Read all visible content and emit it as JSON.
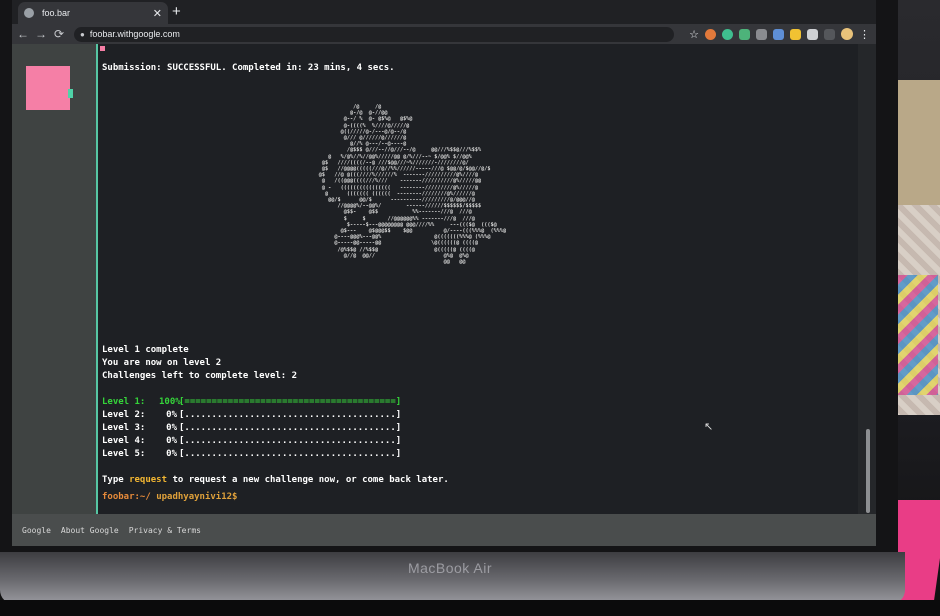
{
  "browser": {
    "tab_title": "foo.bar",
    "tab_close": "✕",
    "new_tab": "+",
    "back": "←",
    "forward": "→",
    "reload": "⟳",
    "lock_icon": "🔒",
    "url": "foobar.withgoogle.com",
    "star": "☆",
    "menu": "⋮"
  },
  "terminal": {
    "submission": "Submission: SUCCESSFUL. Completed in: 23 mins, 4 secs.",
    "level_complete": "Level 1 complete",
    "now_on_level": "You are now on level 2",
    "challenges_left": "Challenges left to complete level: 2",
    "levels": [
      {
        "label": "Level 1:",
        "pct": "100%",
        "bar": "[=======================================]",
        "percent": 100
      },
      {
        "label": "Level 2:",
        "pct": "0%",
        "bar": "[.......................................]",
        "percent": 0
      },
      {
        "label": "Level 3:",
        "pct": "0%",
        "bar": "[.......................................]",
        "percent": 0
      },
      {
        "label": "Level 4:",
        "pct": "0%",
        "bar": "[.......................................]",
        "percent": 0
      },
      {
        "label": "Level 5:",
        "pct": "0%",
        "bar": "[.......................................]",
        "percent": 0
      }
    ],
    "type_prefix": "Type ",
    "type_keyword": "request",
    "type_suffix": " to request a new challenge now, or come back later.",
    "prompt_path": "foobar:~/",
    "prompt_user": " upadhyaynivi12$"
  },
  "footer": {
    "google": "Google",
    "about": "About Google",
    "privacy": "Privacy & Terms"
  },
  "device": {
    "label": "MacBook Air"
  },
  "colors": {
    "accent_green": "#35d33a",
    "keyword_yellow": "#f2b632",
    "logo_pink": "#f57fa6",
    "rule_teal": "#56c6a3"
  }
}
